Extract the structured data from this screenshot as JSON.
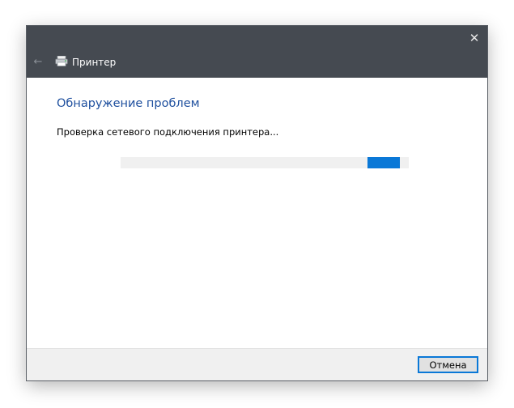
{
  "window": {
    "title": "Принтер",
    "close_glyph": "✕",
    "back_glyph": "←",
    "app_icon": "printer-icon"
  },
  "content": {
    "heading": "Обнаружение проблем",
    "status_text": "Проверка сетевого подключения принтера...",
    "progress": {
      "mode": "indeterminate",
      "chunk_start_fraction": 0.858,
      "chunk_width_fraction": 0.11
    }
  },
  "footer": {
    "cancel_label": "Отмена"
  },
  "colors": {
    "titlebar": "#454a51",
    "heading": "#1e4f9e",
    "accent": "#0a78d7",
    "footer": "#f0f0f0"
  }
}
